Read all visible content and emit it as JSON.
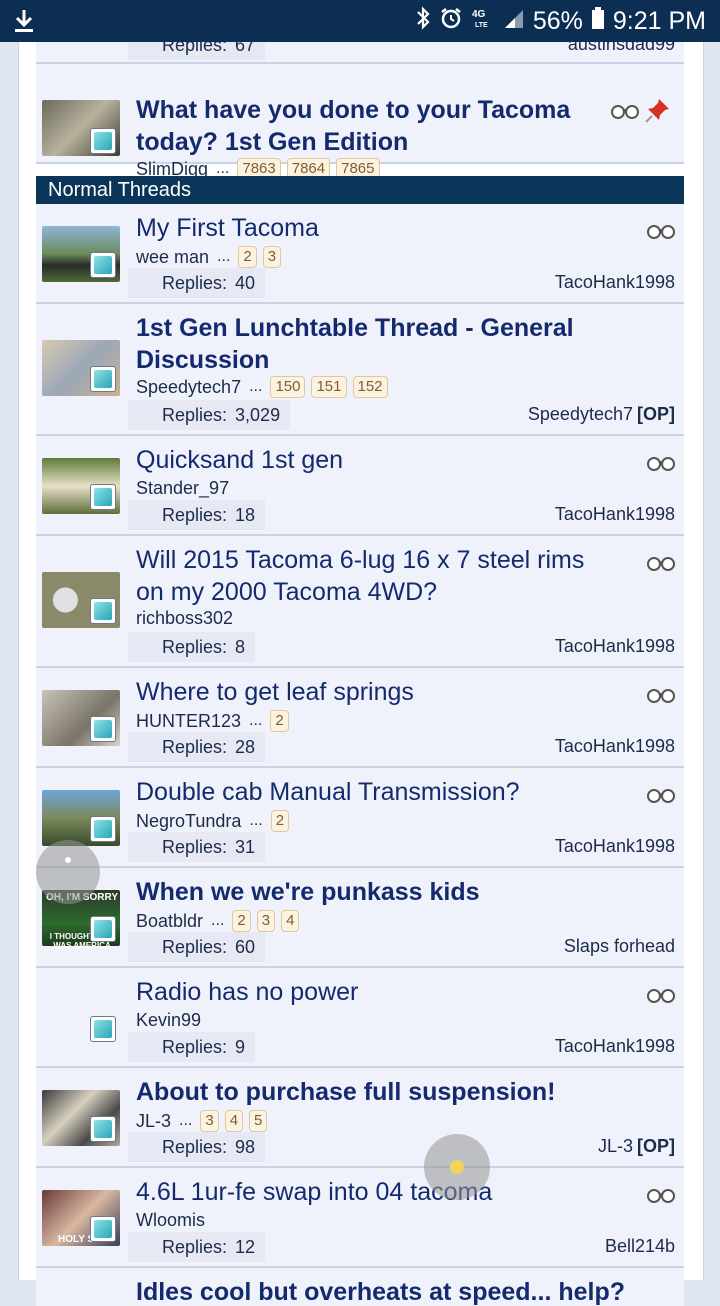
{
  "status_bar": {
    "battery": "56%",
    "time": "9:21 PM",
    "network": "4G LTE"
  },
  "colors": {
    "section_header": "#0b3558",
    "title_blue": "#142a6e",
    "row_bg": "#f0f2fb",
    "status_bar": "#0b2e52"
  },
  "top_row": {
    "replies_label": "Replies:",
    "replies_value": "67",
    "last_poster": "austinsdad99"
  },
  "sticky_thread": {
    "title": "What have you done to your Tacoma today? 1st Gen Edition",
    "author": "SlimDigg",
    "pages": [
      "7863",
      "7864",
      "7865"
    ]
  },
  "section_header": "Normal Threads",
  "threads": [
    {
      "title": "My First Tacoma",
      "author": "wee man",
      "pages": [
        "2",
        "3"
      ],
      "replies": "40",
      "last": "TacoHank1998",
      "op": "",
      "bold": false,
      "watch": true
    },
    {
      "title": "1st Gen Lunchtable Thread - General Discussion",
      "author": "Speedytech7",
      "pages": [
        "150",
        "151",
        "152"
      ],
      "replies": "3,029",
      "last": "Speedytech7",
      "op": "[OP]",
      "bold": true,
      "watch": false
    },
    {
      "title": "Quicksand 1st gen",
      "author": "Stander_97",
      "pages": [],
      "replies": "18",
      "last": "TacoHank1998",
      "op": "",
      "bold": false,
      "watch": true
    },
    {
      "title": "Will 2015 Tacoma 6-lug 16 x 7 steel rims on my 2000 Tacoma 4WD?",
      "author": "richboss302",
      "pages": [],
      "replies": "8",
      "last": "TacoHank1998",
      "op": "",
      "bold": false,
      "watch": true
    },
    {
      "title": "Where to get leaf springs",
      "author": "HUNTER123",
      "pages": [
        "2"
      ],
      "replies": "28",
      "last": "TacoHank1998",
      "op": "",
      "bold": false,
      "watch": true
    },
    {
      "title": "Double cab Manual Transmission?",
      "author": "NegroTundra",
      "pages": [
        "2"
      ],
      "replies": "31",
      "last": "TacoHank1998",
      "op": "",
      "bold": false,
      "watch": true
    },
    {
      "title": "When we we're punkass kids",
      "author": "Boatbldr",
      "pages": [
        "2",
        "3",
        "4"
      ],
      "replies": "60",
      "last": "Slaps forhead",
      "op": "",
      "bold": true,
      "watch": false
    },
    {
      "title": "Radio has no power",
      "author": "Kevin99",
      "pages": [],
      "replies": "9",
      "last": "TacoHank1998",
      "op": "",
      "bold": false,
      "watch": true
    },
    {
      "title": "About to purchase full suspension!",
      "author": "JL-3",
      "pages": [
        "3",
        "4",
        "5"
      ],
      "replies": "98",
      "last": "JL-3",
      "op": "[OP]",
      "bold": true,
      "watch": false
    },
    {
      "title": "4.6L 1ur-fe swap into 04 tacoma",
      "author": "Wloomis",
      "pages": [],
      "replies": "12",
      "last": "Bell214b",
      "op": "",
      "bold": false,
      "watch": true
    }
  ],
  "bottom_thread": {
    "title": "Idles cool but overheats at speed... help?"
  },
  "labels": {
    "replies": "Replies:",
    "ellipsis": "..."
  },
  "thumb_text": {
    "kids_top": "OH, I'M SORRY",
    "kids_bottom": "I THOUGHT THIS WAS AMERICA",
    "swap": "HOLY S"
  }
}
